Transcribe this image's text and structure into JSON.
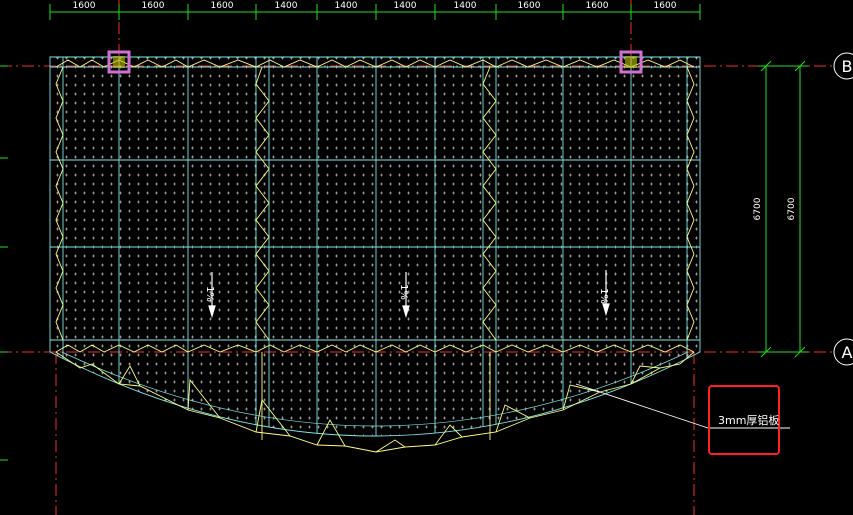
{
  "colors": {
    "background": "#000000",
    "grid_cyan": "#7fe6e6",
    "truss_yellow": "#ffff80",
    "dim_green": "#22dd22",
    "axis_red": "#ee3030",
    "column_magenta": "#d070d0",
    "callout_box_red": "#ff2020",
    "dots_white": "#ffffff"
  },
  "top_dimensions": [
    "1600",
    "1600",
    "1600",
    "1400",
    "1400",
    "1400",
    "1400",
    "1600",
    "1600",
    "1600"
  ],
  "right_dimensions": {
    "inner": "6700",
    "outer": "6700"
  },
  "axis_bubbles": {
    "top": "B",
    "bottom": "A"
  },
  "slope_labels": [
    "1%",
    "1%",
    "1%"
  ],
  "callout": {
    "text": "3mm厚铝板"
  }
}
